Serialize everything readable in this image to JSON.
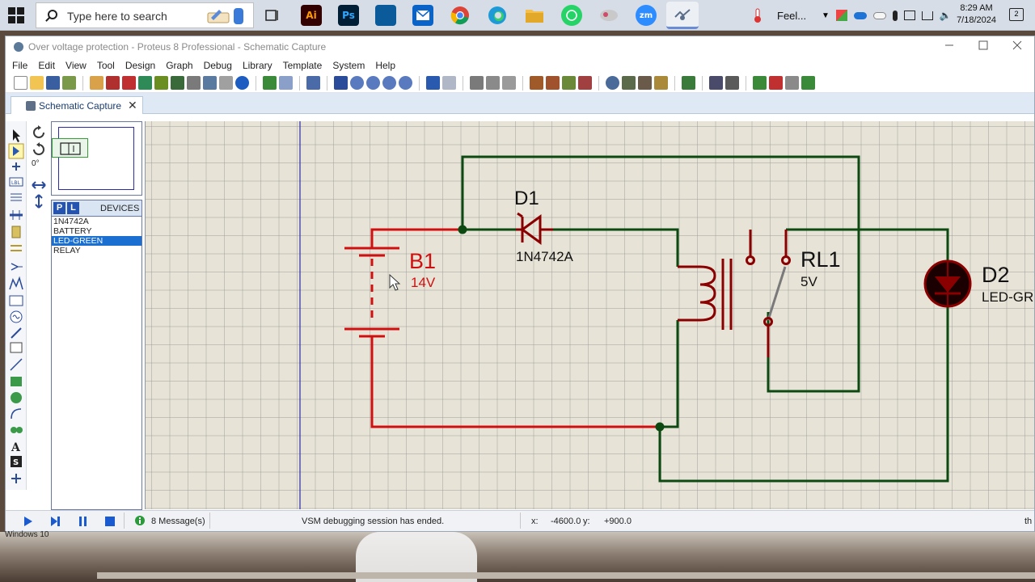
{
  "taskbar": {
    "search_placeholder": "Type here to search",
    "apps": [
      {
        "name": "task-view",
        "label": ""
      },
      {
        "name": "illustrator",
        "label": "Ai"
      },
      {
        "name": "photoshop",
        "label": "Ps"
      },
      {
        "name": "app-blue",
        "label": ""
      },
      {
        "name": "outlook",
        "label": ""
      },
      {
        "name": "chrome",
        "label": ""
      },
      {
        "name": "edge",
        "label": ""
      },
      {
        "name": "file-explorer",
        "label": ""
      },
      {
        "name": "whatsapp",
        "label": ""
      },
      {
        "name": "app-misc",
        "label": ""
      },
      {
        "name": "zoom",
        "label": "zm"
      },
      {
        "name": "proteus",
        "label": ""
      }
    ],
    "weather_text": "Feel...",
    "time": "8:29 AM",
    "date": "7/18/2024",
    "notification_count": "2"
  },
  "window": {
    "title": "Over voltage protection - Proteus 8 Professional - Schematic Capture",
    "menu": [
      "File",
      "Edit",
      "View",
      "Tool",
      "Design",
      "Graph",
      "Debug",
      "Library",
      "Template",
      "System",
      "Help"
    ],
    "tab_label": "Schematic Capture"
  },
  "left_panel": {
    "rotation": "0°",
    "devices_header": "DEVICES",
    "p_button": "P",
    "l_button": "L",
    "devices": [
      "1N4742A",
      "BATTERY",
      "LED-GREEN",
      "RELAY"
    ],
    "selected_device": "LED-GREEN"
  },
  "schematic": {
    "battery": {
      "ref": "B1",
      "value": "14V"
    },
    "diode": {
      "ref": "D1",
      "value": "1N4742A"
    },
    "relay": {
      "ref": "RL1",
      "value": "5V"
    },
    "led": {
      "ref": "D2",
      "value": "LED-GR"
    },
    "colors": {
      "wire_green": "#0d4a12",
      "wire_red": "#d01010",
      "part": "#8a0000",
      "grid_bg": "#e7e3d6"
    }
  },
  "status": {
    "messages": "8 Message(s)",
    "text": "VSM debugging session has ended.",
    "x_label": "x:",
    "x_value": "-4600.0",
    "y_label": "y:",
    "y_value": "+900.0",
    "right_clip": "th"
  },
  "bottom_overlay": "Windows 10"
}
